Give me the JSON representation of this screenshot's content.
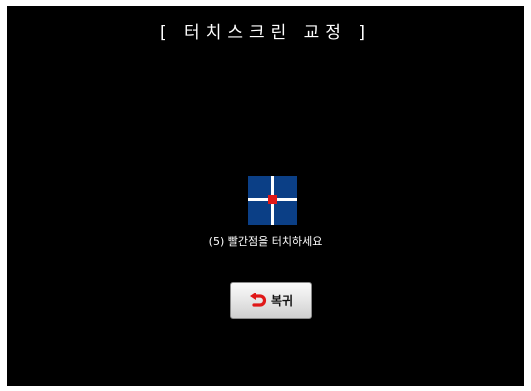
{
  "screen": {
    "title": "[ 터치스크린 교정 ]",
    "instruction": "(5) 빨간점을 터치하세요",
    "target_icon": "calibration-crosshair-icon",
    "back_button": {
      "label": "복귀",
      "icon": "return-arrow-icon"
    }
  },
  "colors": {
    "background": "#000000",
    "target_fill": "#0b3f86",
    "target_dot": "#e01818",
    "back_icon": "#e01818"
  }
}
